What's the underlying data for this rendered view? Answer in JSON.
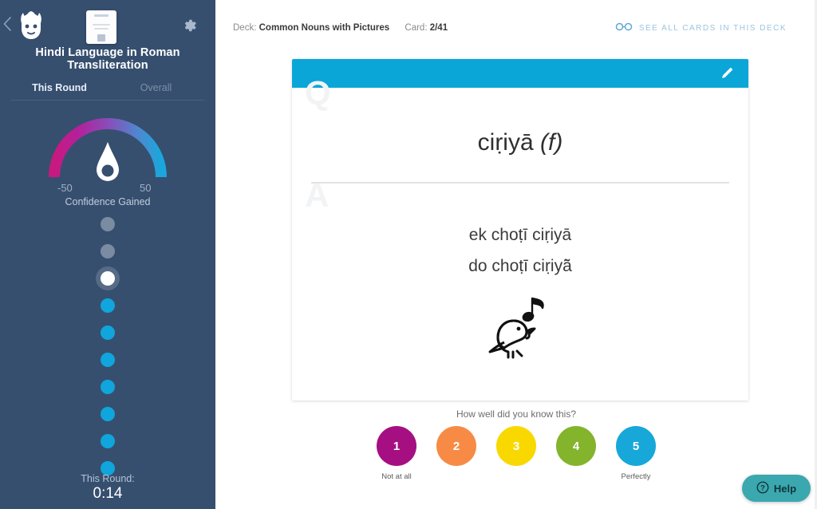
{
  "sidebar": {
    "back_icon": "chevron-left-icon",
    "logo_icon": "memrise-mascot-logo",
    "deck_thumbnail_icon": "deck-card-thumbnail",
    "settings_icon": "gear-icon",
    "course_title": "Hindi Language in Roman Transliteration",
    "tabs": [
      {
        "label": "This Round",
        "active": true
      },
      {
        "label": "Overall",
        "active": false
      }
    ],
    "gauge": {
      "min_label": "-50",
      "max_label": "50",
      "caption": "Confidence Gained",
      "needle_icon": "gauge-needle",
      "gradient_start": "#c9197f",
      "gradient_mid": "#8b4ab3",
      "gradient_end": "#1aa7dd"
    },
    "progress_dots": [
      {
        "state": "upcoming"
      },
      {
        "state": "upcoming"
      },
      {
        "state": "current"
      },
      {
        "state": "done"
      },
      {
        "state": "done"
      },
      {
        "state": "done"
      },
      {
        "state": "done"
      },
      {
        "state": "done"
      },
      {
        "state": "done"
      },
      {
        "state": "done"
      }
    ],
    "footer": {
      "timer_label": "This Round:",
      "timer_value": "0:14"
    },
    "background_color": "#364f6f"
  },
  "topbar": {
    "deck_prefix": "Deck:",
    "deck_name": "Common Nouns with Pictures",
    "card_prefix": "Card:",
    "card_position": "2/41",
    "see_all_label": "See all cards in this deck",
    "see_all_icon": "glasses-icon"
  },
  "card": {
    "header_color": "#0aa6d8",
    "edit_icon": "pencil-icon",
    "watermark_question": "Q",
    "watermark_answer": "A",
    "prompt_word": "ciṛiyā",
    "prompt_gender": "(f)",
    "answers": [
      "ek choṭī ciṛiyā",
      "do choṭī ciṛiyā̃"
    ],
    "illustration_icon": "singing-bird-icon"
  },
  "rating": {
    "question": "How well did you know this?",
    "buttons": [
      {
        "value": "1",
        "color": "#a50f82",
        "caption": "Not at all"
      },
      {
        "value": "2",
        "color": "#f78b45",
        "caption": ""
      },
      {
        "value": "3",
        "color": "#f9d800",
        "caption": ""
      },
      {
        "value": "4",
        "color": "#84b32c",
        "caption": ""
      },
      {
        "value": "5",
        "color": "#17a8d9",
        "caption": "Perfectly"
      }
    ]
  },
  "help": {
    "label": "Help",
    "icon": "question-mark-icon",
    "color": "#3aa8ae"
  }
}
